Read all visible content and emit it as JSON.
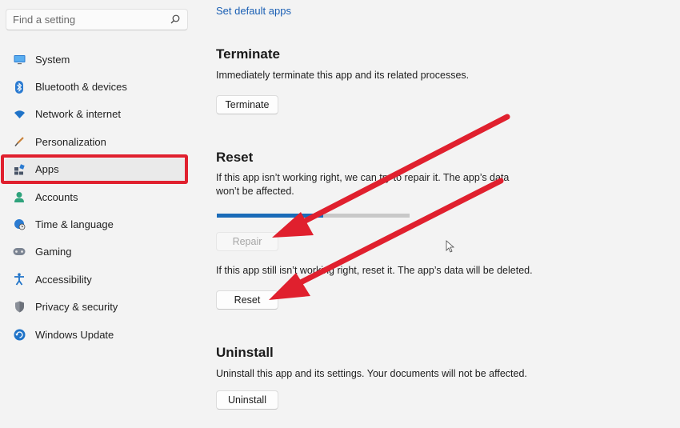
{
  "search": {
    "placeholder": "Find a setting"
  },
  "sidebar": {
    "items": [
      {
        "label": "System",
        "icon": "monitor-icon"
      },
      {
        "label": "Bluetooth & devices",
        "icon": "bluetooth-icon"
      },
      {
        "label": "Network & internet",
        "icon": "wifi-icon"
      },
      {
        "label": "Personalization",
        "icon": "brush-icon"
      },
      {
        "label": "Apps",
        "icon": "apps-icon",
        "selected": true
      },
      {
        "label": "Accounts",
        "icon": "person-icon"
      },
      {
        "label": "Time & language",
        "icon": "globe-clock-icon"
      },
      {
        "label": "Gaming",
        "icon": "gamepad-icon"
      },
      {
        "label": "Accessibility",
        "icon": "accessibility-icon"
      },
      {
        "label": "Privacy & security",
        "icon": "shield-icon"
      },
      {
        "label": "Windows Update",
        "icon": "update-icon"
      }
    ]
  },
  "main": {
    "default_apps_link": "Set default apps",
    "terminate": {
      "title": "Terminate",
      "description": "Immediately terminate this app and its related processes.",
      "button": "Terminate"
    },
    "reset": {
      "title": "Reset",
      "repair_description": "If this app isn’t working right, we can try to repair it. The app’s data won’t be affected.",
      "repair_progress": 0.55,
      "repair_button": "Repair",
      "reset_description": "If this app still isn’t working right, reset it. The app’s data will be deleted.",
      "reset_button": "Reset"
    },
    "uninstall": {
      "title": "Uninstall",
      "description": "Uninstall this app and its settings. Your documents will not be affected.",
      "button": "Uninstall"
    }
  },
  "colors": {
    "accent": "#1a6bb8",
    "annotation_red": "#e0202e",
    "background": "#f3f3f3"
  }
}
